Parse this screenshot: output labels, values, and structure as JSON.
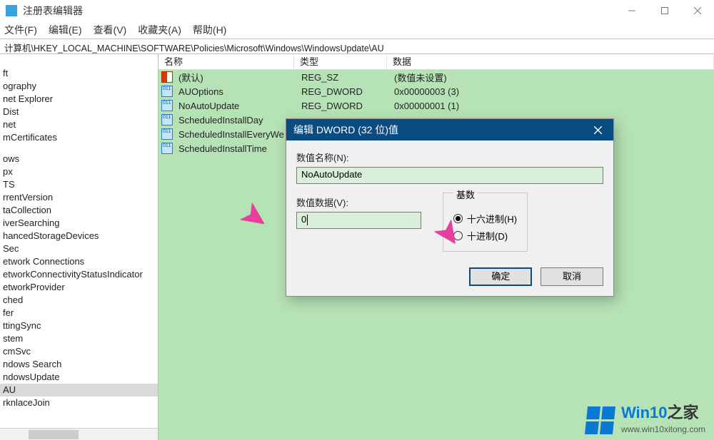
{
  "window": {
    "title": "注册表编辑器",
    "menu": [
      "文件(F)",
      "编辑(E)",
      "查看(V)",
      "收藏夹(A)",
      "帮助(H)"
    ],
    "address": "计算机\\HKEY_LOCAL_MACHINE\\SOFTWARE\\Policies\\Microsoft\\Windows\\WindowsUpdate\\AU"
  },
  "tree": [
    "ft",
    "ography",
    "net Explorer",
    "Dist",
    "net",
    "mCertificates",
    "ows",
    "px",
    "TS",
    "rrentVersion",
    "taCollection",
    "iverSearching",
    "hancedStorageDevices",
    "Sec",
    "etwork Connections",
    "etworkConnectivityStatusIndicator",
    "etworkProvider",
    "ched",
    "fer",
    "ttingSync",
    "stem",
    "cmSvc",
    "ndows Search",
    "ndowsUpdate",
    "AU",
    "rknlaceJoin"
  ],
  "tree_selected_index": 24,
  "columns": {
    "name": "名称",
    "type": "类型",
    "data": "数据"
  },
  "rows": [
    {
      "icon": "sz",
      "name": "(默认)",
      "type": "REG_SZ",
      "data": "(数值未设置)"
    },
    {
      "icon": "dw",
      "name": "AUOptions",
      "type": "REG_DWORD",
      "data": "0x00000003 (3)"
    },
    {
      "icon": "dw",
      "name": "NoAutoUpdate",
      "type": "REG_DWORD",
      "data": "0x00000001 (1)"
    },
    {
      "icon": "dw",
      "name": "ScheduledInstallDay",
      "type": "",
      "data": ""
    },
    {
      "icon": "dw",
      "name": "ScheduledInstallEveryWe",
      "type": "",
      "data": ""
    },
    {
      "icon": "dw",
      "name": "ScheduledInstallTime",
      "type": "",
      "data": ""
    }
  ],
  "dialog": {
    "title": "编辑 DWORD (32 位)值",
    "name_label": "数值名称(N):",
    "name_value": "NoAutoUpdate",
    "data_label": "数值数据(V):",
    "data_value": "0",
    "base_label": "基数",
    "base_hex": "十六进制(H)",
    "base_dec": "十进制(D)",
    "ok": "确定",
    "cancel": "取消"
  },
  "watermark": {
    "brand1": "Win10",
    "brand2": "之家",
    "url": "www.win10xitong.com"
  }
}
